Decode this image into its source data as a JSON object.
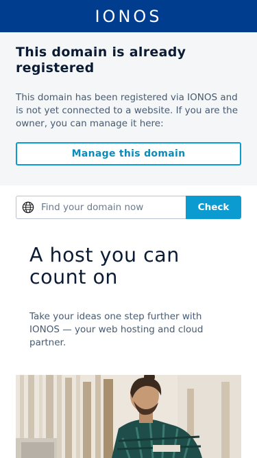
{
  "header": {
    "logo": "IONOS"
  },
  "notice": {
    "title": "This domain is already registered",
    "body": "This domain has been registered via IONOS and is not yet connected to a website. If you are the owner, you can manage it here:",
    "button_label": "Manage this domain"
  },
  "search": {
    "placeholder": "Find your domain now",
    "button_label": "Check",
    "icon": "globe-icon"
  },
  "hero": {
    "title": "A host you can count on",
    "text": "Take your ideas one step further with IONOS — your web hosting and cloud partner."
  },
  "colors": {
    "header_bg": "#003d8f",
    "accent": "#0b9bd0",
    "notice_bg": "#f4f6f8",
    "heading": "#0b1b33",
    "body_text": "#465a71"
  }
}
